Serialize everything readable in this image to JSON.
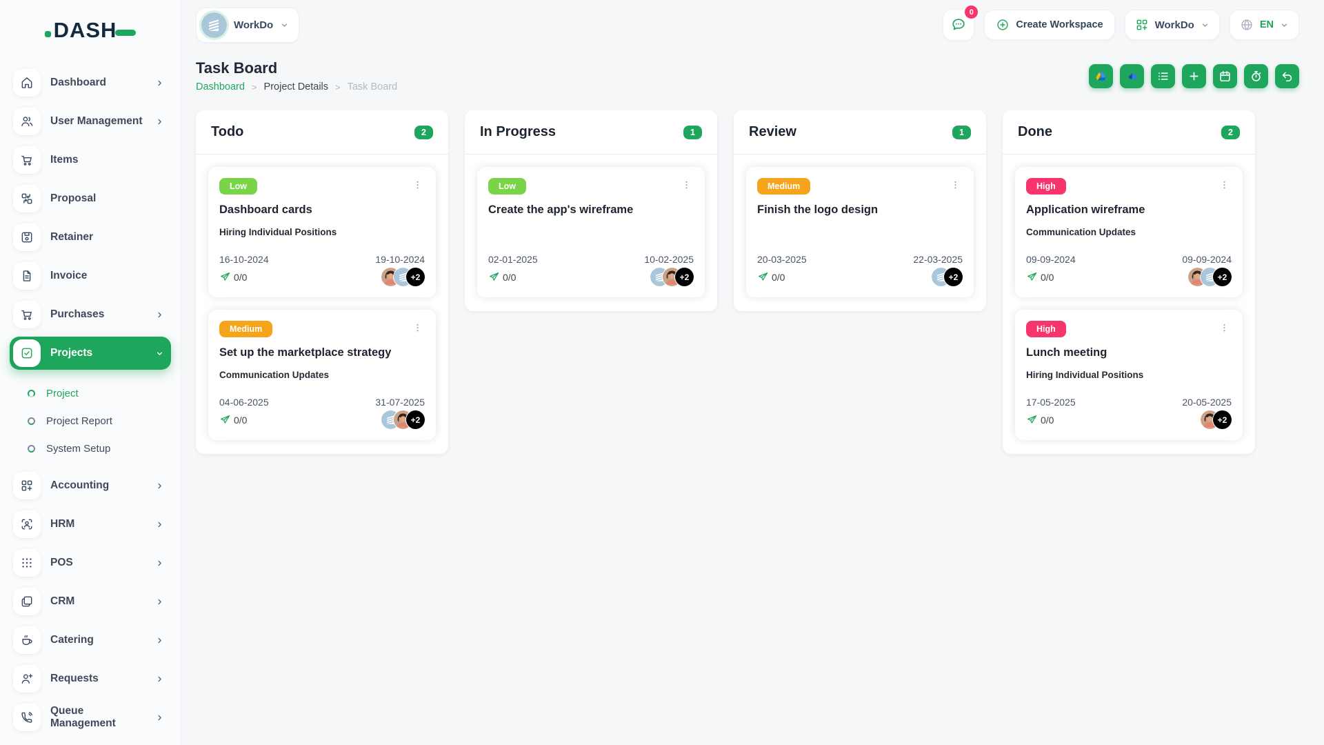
{
  "colors": {
    "primary": "#1ea65d",
    "low": "#7ad448",
    "medium": "#f7a41d",
    "high": "#f8346c",
    "notification": "#f8346c",
    "breadcrumb_link": "#1ea65d"
  },
  "brand": {
    "logo_text": "DASH"
  },
  "topbar": {
    "workspace": {
      "label": "WorkDo",
      "avatar": "building"
    },
    "messages": {
      "count": "0"
    },
    "create_workspace": {
      "label": "Create Workspace"
    },
    "app_menu": {
      "label": "WorkDo"
    },
    "language": {
      "label": "EN"
    }
  },
  "sidebar": {
    "items": [
      {
        "id": "dashboard",
        "label": "Dashboard",
        "icon": "home-icon",
        "chevron": "right"
      },
      {
        "id": "user-management",
        "label": "User Management",
        "icon": "users-icon",
        "chevron": "right"
      },
      {
        "id": "items",
        "label": "Items",
        "icon": "cart-icon"
      },
      {
        "id": "proposal",
        "label": "Proposal",
        "icon": "proposal-icon"
      },
      {
        "id": "retainer",
        "label": "Retainer",
        "icon": "save-icon"
      },
      {
        "id": "invoice",
        "label": "Invoice",
        "icon": "file-icon"
      },
      {
        "id": "purchases",
        "label": "Purchases",
        "icon": "cart-icon",
        "chevron": "right"
      },
      {
        "id": "projects",
        "label": "Projects",
        "icon": "check-square-icon",
        "chevron": "down",
        "active": true,
        "children": [
          {
            "id": "project",
            "label": "Project",
            "active": true
          },
          {
            "id": "project-report",
            "label": "Project Report"
          },
          {
            "id": "system-setup",
            "label": "System Setup"
          }
        ]
      },
      {
        "id": "accounting",
        "label": "Accounting",
        "icon": "grid-plus-icon",
        "chevron": "right"
      },
      {
        "id": "hrm",
        "label": "HRM",
        "icon": "user-scan-icon",
        "chevron": "right"
      },
      {
        "id": "pos",
        "label": "POS",
        "icon": "dots-grid-icon",
        "chevron": "right"
      },
      {
        "id": "crm",
        "label": "CRM",
        "icon": "frames-icon",
        "chevron": "right"
      },
      {
        "id": "catering",
        "label": "Catering",
        "icon": "coffee-icon",
        "chevron": "right"
      },
      {
        "id": "requests",
        "label": "Requests",
        "icon": "user-plus-icon",
        "chevron": "right"
      },
      {
        "id": "queue-management",
        "label": "Queue Management",
        "icon": "phone-icon",
        "chevron": "right"
      }
    ]
  },
  "page": {
    "title": "Task Board",
    "breadcrumb": [
      {
        "label": "Dashboard",
        "type": "link"
      },
      {
        "label": "Project Details",
        "type": "mid"
      },
      {
        "label": "Task Board",
        "type": "current"
      }
    ],
    "toolbar": [
      {
        "id": "google-drive",
        "icon": "google-drive-icon"
      },
      {
        "id": "onedrive",
        "icon": "onedrive-icon"
      },
      {
        "id": "milestone-list",
        "icon": "list-icon"
      },
      {
        "id": "add-task",
        "icon": "plus-icon"
      },
      {
        "id": "calendar",
        "icon": "calendar-icon"
      },
      {
        "id": "tracker",
        "icon": "timer-icon"
      },
      {
        "id": "back",
        "icon": "undo-icon"
      }
    ]
  },
  "board": {
    "columns": [
      {
        "id": "todo",
        "title": "Todo",
        "count": "2",
        "cards": [
          {
            "priority": "Low",
            "priority_color": "low",
            "title": "Dashboard cards",
            "milestone": "Hiring Individual Positions",
            "start_date": "16-10-2024",
            "end_date": "19-10-2024",
            "progress": "0/0",
            "avatars": [
              "person",
              "building"
            ],
            "extra_count": "+2"
          },
          {
            "priority": "Medium",
            "priority_color": "medium",
            "title": "Set up the marketplace strategy",
            "milestone": "Communication Updates",
            "start_date": "04-06-2025",
            "end_date": "31-07-2025",
            "progress": "0/0",
            "avatars": [
              "building",
              "person"
            ],
            "extra_count": "+2"
          }
        ]
      },
      {
        "id": "in-progress",
        "title": "In Progress",
        "count": "1",
        "cards": [
          {
            "priority": "Low",
            "priority_color": "low",
            "title": "Create the app's wireframe",
            "milestone": "",
            "start_date": "02-01-2025",
            "end_date": "10-02-2025",
            "progress": "0/0",
            "avatars": [
              "building",
              "person"
            ],
            "extra_count": "+2"
          }
        ]
      },
      {
        "id": "review",
        "title": "Review",
        "count": "1",
        "cards": [
          {
            "priority": "Medium",
            "priority_color": "medium",
            "title": "Finish the logo design",
            "milestone": "",
            "start_date": "20-03-2025",
            "end_date": "22-03-2025",
            "progress": "0/0",
            "avatars": [
              "building"
            ],
            "extra_count": "+2"
          }
        ]
      },
      {
        "id": "done",
        "title": "Done",
        "count": "2",
        "cards": [
          {
            "priority": "High",
            "priority_color": "high",
            "title": "Application wireframe",
            "milestone": "Communication Updates",
            "start_date": "09-09-2024",
            "end_date": "09-09-2024",
            "progress": "0/0",
            "avatars": [
              "person",
              "building"
            ],
            "extra_count": "+2"
          },
          {
            "priority": "High",
            "priority_color": "high",
            "title": "Lunch meeting",
            "milestone": "Hiring Individual Positions",
            "start_date": "17-05-2025",
            "end_date": "20-05-2025",
            "progress": "0/0",
            "avatars": [
              "person"
            ],
            "extra_count": "+2"
          }
        ]
      }
    ]
  }
}
